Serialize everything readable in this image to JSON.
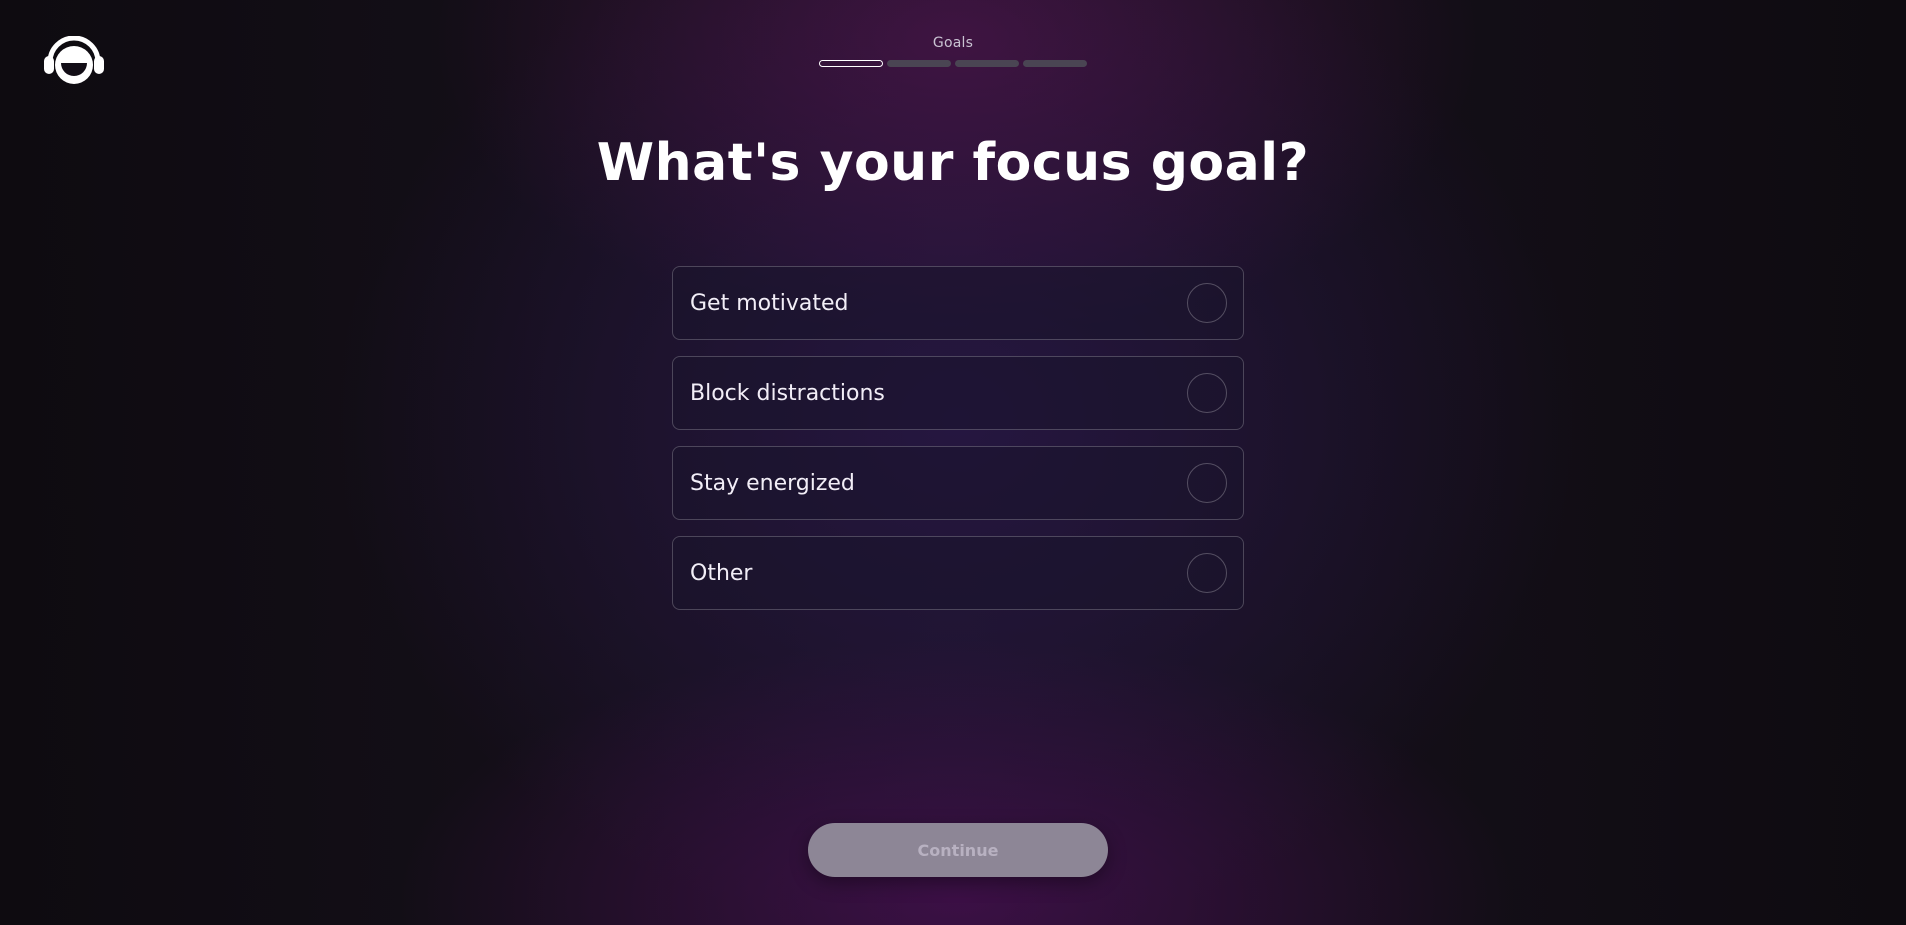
{
  "header": {
    "logo_icon": "headphones-face-icon",
    "progress_label": "Goals",
    "progress": {
      "total_steps": 4,
      "current_step": 1
    }
  },
  "main": {
    "title": "What's your focus goal?",
    "options": [
      {
        "label": "Get motivated",
        "selected": false
      },
      {
        "label": "Block distractions",
        "selected": false
      },
      {
        "label": "Stay energized",
        "selected": false
      },
      {
        "label": "Other",
        "selected": false
      }
    ]
  },
  "footer": {
    "continue_label": "Continue",
    "continue_disabled": true
  },
  "colors": {
    "background": "#130e17",
    "accent_glow": "#5a1455",
    "button_disabled": "#8d8696",
    "text": "#ffffff"
  }
}
